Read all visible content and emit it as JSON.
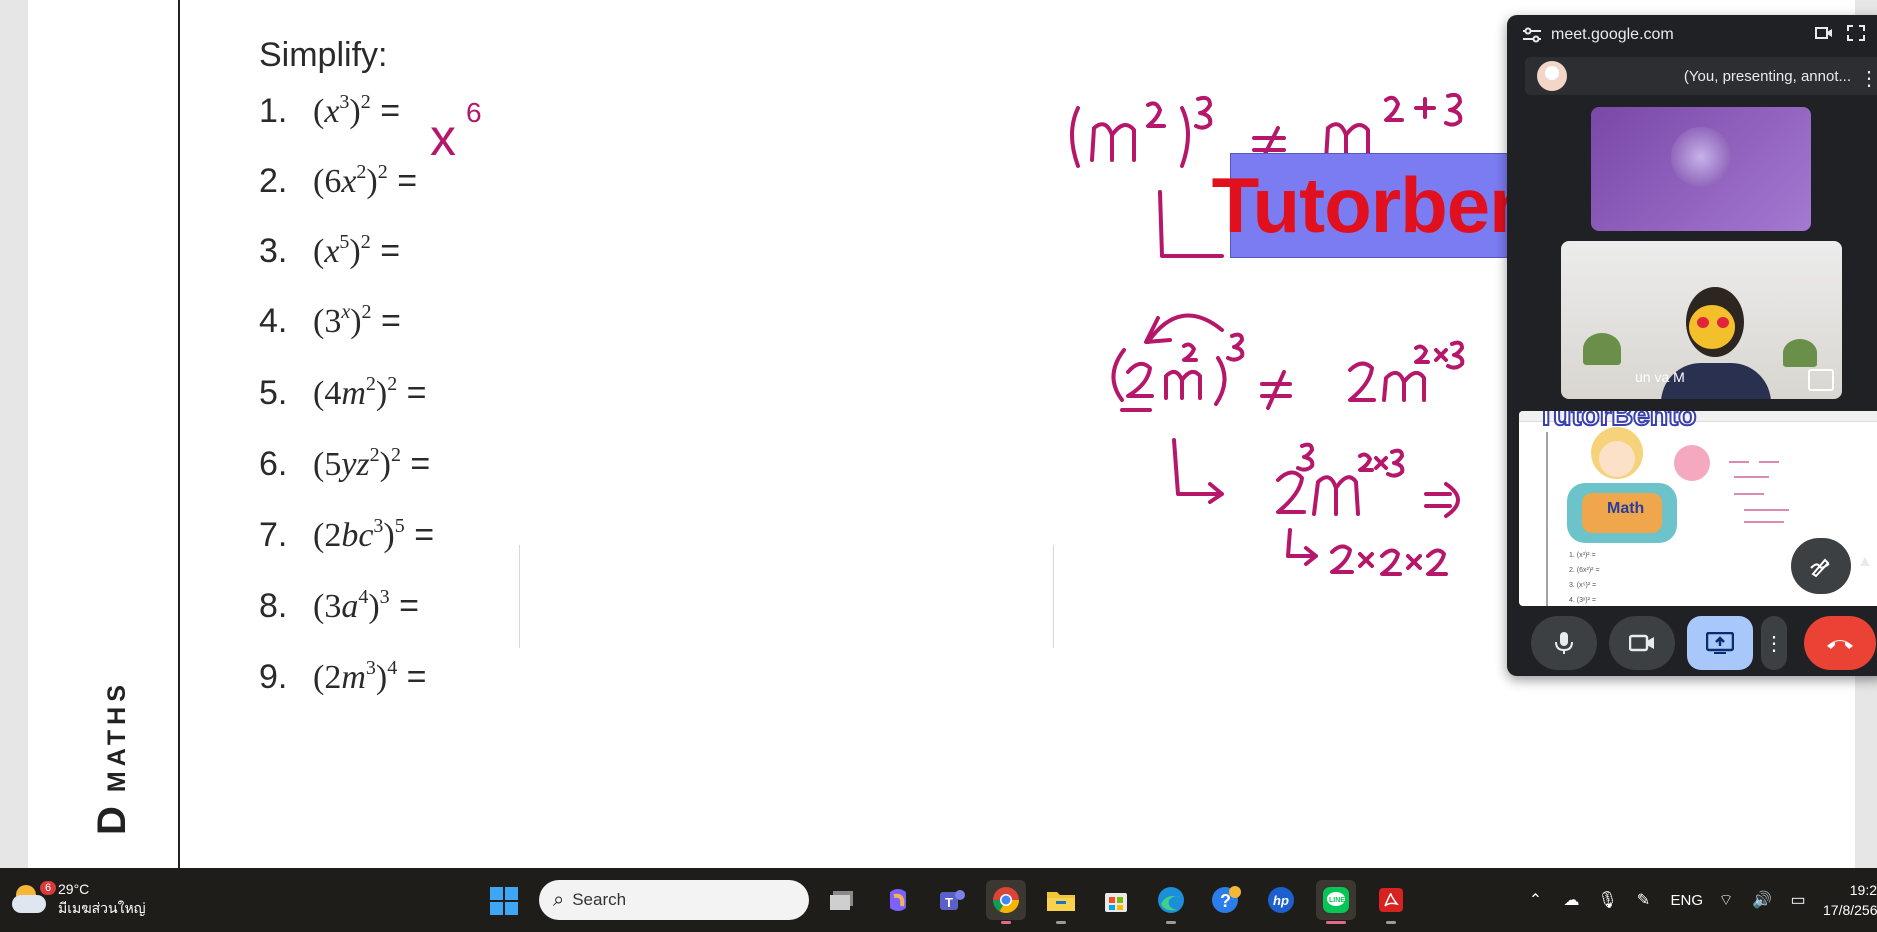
{
  "worksheet": {
    "brand_vertical": "MATHS",
    "brand_letter": "D",
    "title": "Simplify:",
    "questions": [
      {
        "num": "1.",
        "base": "(",
        "var": "x",
        "inner": "3",
        "outer": "2",
        "suffix": " ="
      },
      {
        "num": "2.",
        "base": "(6",
        "var": "x",
        "inner": "2",
        "outer": "2",
        "suffix": " ="
      },
      {
        "num": "3.",
        "base": "(",
        "var": "x",
        "inner": "5",
        "outer": "2",
        "suffix": " ="
      },
      {
        "num": "4.",
        "base": "(3",
        "var": "",
        "inner": "x",
        "outer": "2",
        "suffix": " ="
      },
      {
        "num": "5.",
        "base": "(4",
        "var": "m",
        "inner": "2",
        "outer": "2",
        "suffix": " ="
      },
      {
        "num": "6.",
        "base": "(5",
        "var": "yz",
        "inner": "2",
        "outer": "2",
        "suffix": " ="
      },
      {
        "num": "7.",
        "base": "(2",
        "var": "bc",
        "inner": "3",
        "outer": "5",
        "suffix": " ="
      },
      {
        "num": "8.",
        "base": "(3",
        "var": "a",
        "inner": "4",
        "outer": "3",
        "suffix": " ="
      },
      {
        "num": "9.",
        "base": "(2",
        "var": "m",
        "inner": "3",
        "outer": "4",
        "suffix": " ="
      }
    ]
  },
  "annotations": {
    "q1_answer": "x",
    "q1_answer_exp": "6",
    "ink_color": "#b5176a"
  },
  "watermark": {
    "text": "Tutorbento.com"
  },
  "meet": {
    "url": "meet.google.com",
    "presenting_label": "(You, presenting, annot...",
    "participant_name": "un   va M",
    "share_lines": [
      "1. (x³)² =",
      "2. (6x²)² =",
      "3. (x⁵)² =",
      "4. (3ˣ)² ="
    ],
    "controls": [
      "microphone",
      "camera",
      "present",
      "more-options",
      "end-call"
    ],
    "accent_color": "#a8c7fa",
    "end_color": "#ea4335"
  },
  "taskbar": {
    "weather_badge": "6",
    "temperature": "29°C",
    "weather_desc": "มีเมฆส่วนใหญ่",
    "search_label": "Search",
    "apps": [
      "file-explorer-like",
      "copilot",
      "teams",
      "chrome",
      "file-explorer",
      "microsoft-store",
      "edge",
      "help",
      "hp",
      "line",
      "acrobat"
    ],
    "language": "ENG",
    "time": "19:2",
    "date": "17/8/256"
  }
}
